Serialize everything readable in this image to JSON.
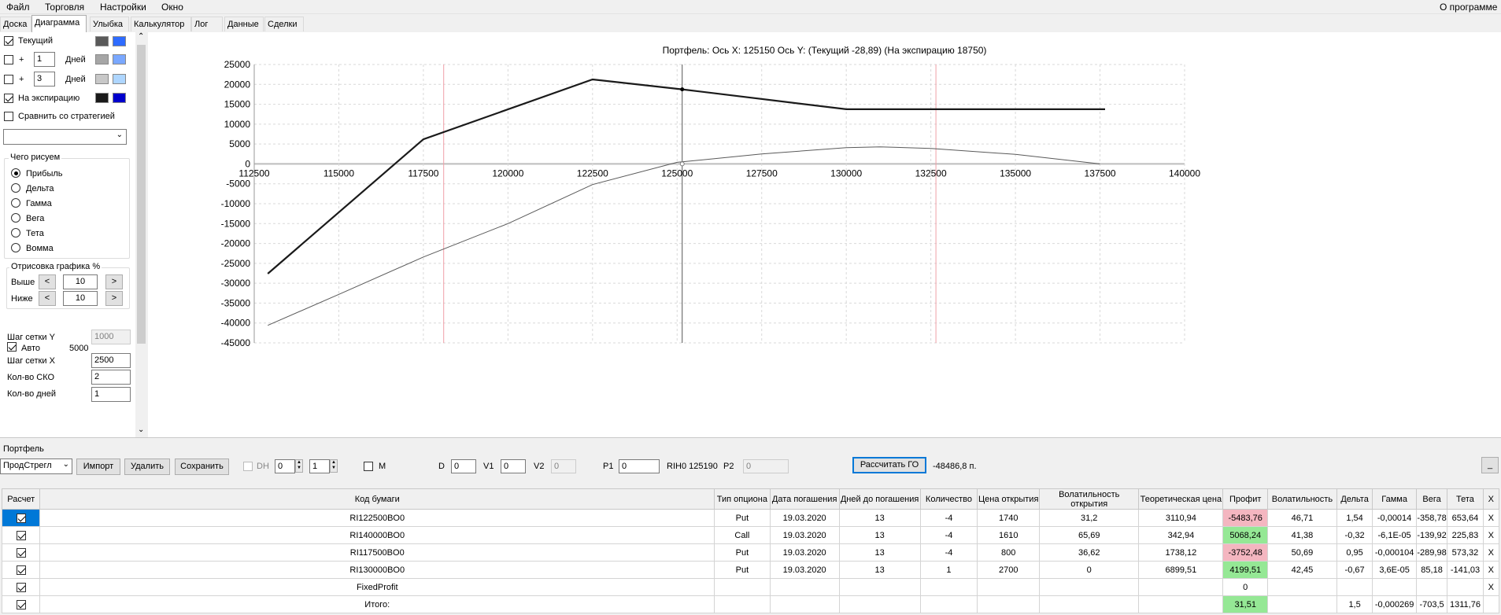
{
  "menu": {
    "file": "Файл",
    "trade": "Торговля",
    "settings": "Настройки",
    "window": "Окно",
    "about": "О программе"
  },
  "tabs": [
    "Доска",
    "Диаграмма",
    "Улыбка",
    "Калькулятор",
    "Лог",
    "Данные",
    "Сделки"
  ],
  "left": {
    "current_label": "Текущий",
    "plus": "+",
    "days_label": "Дней",
    "days1": "1",
    "days2": "3",
    "expiry_label": "На экспирацию",
    "compare_label": "Сравнить со стратегией",
    "draw_group": "Чего рисуем",
    "radios": [
      "Прибыль",
      "Дельта",
      "Гамма",
      "Вега",
      "Тета",
      "Вомма"
    ],
    "render_group": "Отрисовка графика %",
    "above_label": "Выше",
    "below_label": "Ниже",
    "above_value": "10",
    "below_value": "10",
    "lt": "<",
    "gt": ">",
    "grid_y_label": "Шаг сетки Y",
    "grid_y_value": "1000",
    "auto_label": "Авто",
    "auto_value": "5000",
    "grid_x_label": "Шаг сетки X",
    "grid_x_value": "2500",
    "sko_label": "Кол-во СКО",
    "sko_value": "2",
    "days_count_label": "Кол-во дней",
    "days_count_value": "1",
    "colors": {
      "cur_dark": "#595959",
      "cur_light": "#2e6bff",
      "d1_dark": "#a6a6a6",
      "d1_light": "#7aa8ff",
      "d2_dark": "#c8c8c8",
      "d2_light": "#aed6ff",
      "exp_dark": "#1a1a1a",
      "exp_light": "#0000cc"
    }
  },
  "chart_data": {
    "type": "line",
    "title": "Портфель: Ось X:  125150 Ось Y:   (Текущий -28,89)   (На экспирацию  18750)",
    "xlim": [
      112500,
      140000
    ],
    "ylim": [
      -45000,
      25000
    ],
    "xticks": [
      112500,
      115000,
      117500,
      120000,
      122500,
      125000,
      127500,
      130000,
      132500,
      135000,
      137500,
      140000
    ],
    "yticks": [
      25000,
      20000,
      15000,
      10000,
      5000,
      0,
      -5000,
      -10000,
      -15000,
      -20000,
      -25000,
      -30000,
      -35000,
      -40000,
      -45000
    ],
    "vlines_red": [
      118100,
      132650
    ],
    "cursor_x": 125150,
    "series": [
      {
        "points": [
          [
            112900,
            -27600
          ],
          [
            117500,
            6200
          ],
          [
            122500,
            21250
          ],
          [
            125150,
            18750
          ],
          [
            130000,
            13750
          ],
          [
            137650,
            13750
          ]
        ]
      },
      {
        "points": [
          [
            112900,
            -40600
          ],
          [
            115000,
            -32800
          ],
          [
            117500,
            -23400
          ],
          [
            120000,
            -15000
          ],
          [
            122500,
            -5200
          ],
          [
            125000,
            400
          ],
          [
            127500,
            2500
          ],
          [
            130000,
            4100
          ],
          [
            131000,
            4300
          ],
          [
            132500,
            3900
          ],
          [
            135000,
            2400
          ],
          [
            137500,
            0
          ]
        ]
      }
    ]
  },
  "portfolio": {
    "label": "Портфель",
    "strategy_select": "ПродСтрегл",
    "import": "Импорт",
    "delete": "Удалить",
    "save": "Сохранить",
    "dh": "DH",
    "spin1": "0",
    "spin2": "1",
    "m": "M",
    "d_label": "D",
    "d_value": "0",
    "v1_label": "V1",
    "v1_value": "0",
    "v2_label": "V2",
    "v2_value": "0",
    "p1_label": "P1",
    "p1_value": "0",
    "rih": "RIH0 125190",
    "p2_label": "P2",
    "p2_value": "0",
    "calc_go": "Рассчитать ГО",
    "go_value": "-48486,8 п.",
    "minimize": "_"
  },
  "table": {
    "headers": [
      "Расчет",
      "Код бумаги",
      "Тип опциона",
      "Дата погашения",
      "Дней до погашения",
      "Количество",
      "Цена открытия",
      "Волатильность открытия",
      "Теоретическая цена",
      "Профит",
      "Волатильность",
      "Дельта",
      "Гамма",
      "Вега",
      "Тета",
      "X"
    ],
    "rows": [
      {
        "code": "RI122500BO0",
        "type": "Put",
        "date": "19.03.2020",
        "days": "13",
        "qty": "-4",
        "open": "1740",
        "vol_open": "31,2",
        "theo": "3110,94",
        "profit": "-5483,76",
        "vol": "46,71",
        "delta": "1,54",
        "gamma": "-0,00014",
        "vega": "-358,78",
        "theta": "653,64",
        "x": "X"
      },
      {
        "code": "RI140000BO0",
        "type": "Call",
        "date": "19.03.2020",
        "days": "13",
        "qty": "-4",
        "open": "1610",
        "vol_open": "65,69",
        "theo": "342,94",
        "profit": "5068,24",
        "vol": "41,38",
        "delta": "-0,32",
        "gamma": "-6,1E-05",
        "vega": "-139,92",
        "theta": "225,83",
        "x": "X"
      },
      {
        "code": "RI117500BO0",
        "type": "Put",
        "date": "19.03.2020",
        "days": "13",
        "qty": "-4",
        "open": "800",
        "vol_open": "36,62",
        "theo": "1738,12",
        "profit": "-3752,48",
        "vol": "50,69",
        "delta": "0,95",
        "gamma": "-0,000104",
        "vega": "-289,98",
        "theta": "573,32",
        "x": "X"
      },
      {
        "code": "RI130000BO0",
        "type": "Put",
        "date": "19.03.2020",
        "days": "13",
        "qty": "1",
        "open": "2700",
        "vol_open": "0",
        "theo": "6899,51",
        "profit": "4199,51",
        "vol": "42,45",
        "delta": "-0,67",
        "gamma": "3,6E-05",
        "vega": "85,18",
        "theta": "-141,03",
        "x": "X"
      }
    ],
    "fixed": {
      "code": "FixedProfit",
      "profit": "0",
      "x": "X"
    },
    "total": {
      "code": "Итого:",
      "profit": "31,51",
      "delta": "1,5",
      "gamma": "-0,000269",
      "vega": "-703,5",
      "theta": "1311,76"
    }
  }
}
